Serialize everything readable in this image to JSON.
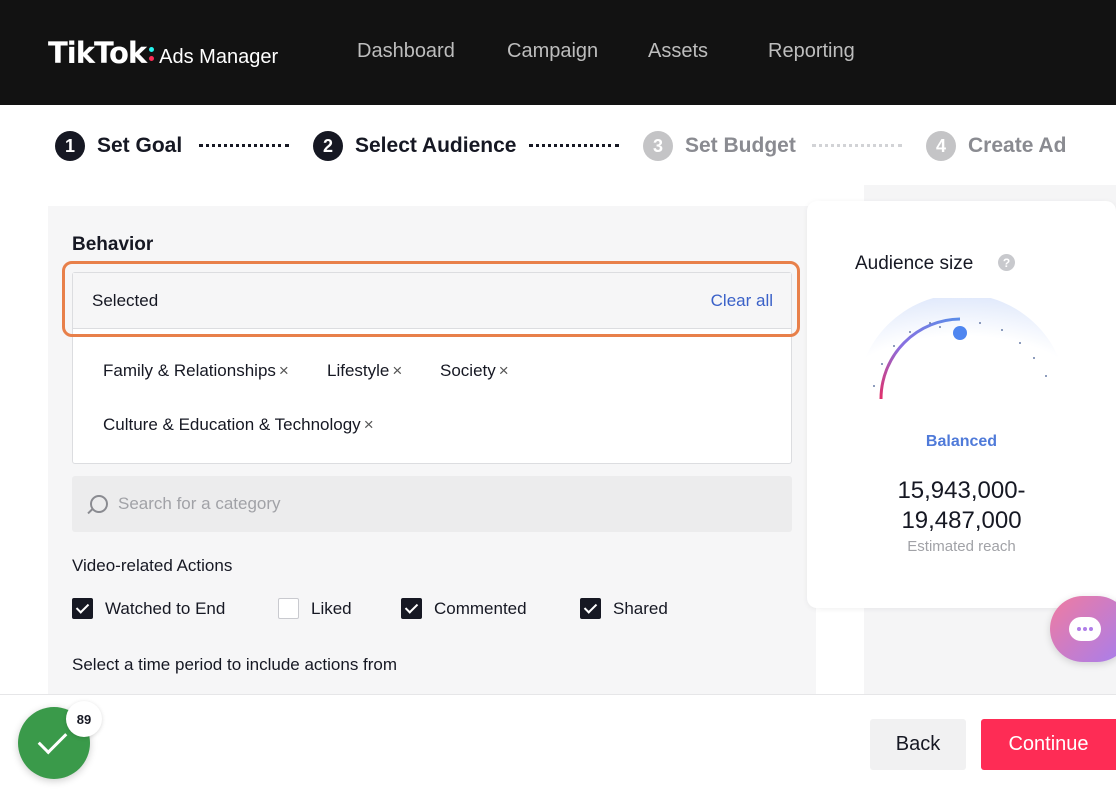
{
  "header": {
    "logo_main": "TikTok",
    "logo_sub": "Ads Manager",
    "nav": [
      "Dashboard",
      "Campaign",
      "Assets",
      "Reporting"
    ]
  },
  "steps": [
    {
      "num": "1",
      "label": "Set Goal",
      "state": "active"
    },
    {
      "num": "2",
      "label": "Select Audience",
      "state": "active"
    },
    {
      "num": "3",
      "label": "Set Budget",
      "state": "inactive"
    },
    {
      "num": "4",
      "label": "Create Ad",
      "state": "inactive"
    }
  ],
  "behavior": {
    "title": "Behavior",
    "selected_label": "Selected",
    "clear_all": "Clear all",
    "tags": [
      "Family & Relationships",
      "Lifestyle",
      "Society",
      "Culture & Education & Technology"
    ],
    "remove_glyph": "×",
    "search_placeholder": "Search for a category",
    "video_actions_title": "Video-related Actions",
    "video_actions": [
      {
        "label": "Watched to End",
        "checked": true
      },
      {
        "label": "Liked",
        "checked": false
      },
      {
        "label": "Commented",
        "checked": true
      },
      {
        "label": "Shared",
        "checked": true
      }
    ],
    "time_period_label": "Select a time period to include actions from"
  },
  "audience": {
    "title": "Audience size",
    "help": "?",
    "status": "Balanced",
    "reach_line1": "15,943,000-",
    "reach_line2": "19,487,000",
    "reach_label": "Estimated reach",
    "colors": {
      "accent": "#4f7ad9",
      "gauge_start": "#e0306b"
    }
  },
  "footer": {
    "score": "89",
    "back": "Back",
    "continue": "Continue",
    "continue_color": "#fe2c55"
  },
  "icons": {
    "search": "search-icon",
    "help": "help-icon",
    "chat": "chat-icon",
    "check": "check-icon"
  }
}
